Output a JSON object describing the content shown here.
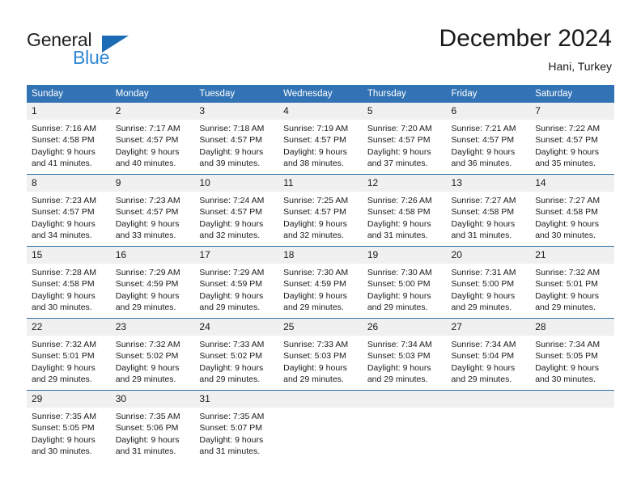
{
  "logo": {
    "word1": "General",
    "word2": "Blue",
    "triangle_color": "#1c6cb5",
    "word2_color": "#2e87d3"
  },
  "header": {
    "title": "December 2024",
    "subtitle": "Hani, Turkey"
  },
  "theme": {
    "header_blue": "#3273b5",
    "row_divider_blue": "#2e6da4",
    "daynum_band": "#f0f0f0"
  },
  "calendar": {
    "weekday_headers": [
      "Sunday",
      "Monday",
      "Tuesday",
      "Wednesday",
      "Thursday",
      "Friday",
      "Saturday"
    ],
    "labels": {
      "sunrise": "Sunrise:",
      "sunset": "Sunset:",
      "daylight": "Daylight:"
    },
    "weeks": [
      [
        {
          "day": "1",
          "sunrise": "Sunrise: 7:16 AM",
          "sunset": "Sunset: 4:58 PM",
          "daylight_line1": "Daylight: 9 hours",
          "daylight_line2": "and 41 minutes."
        },
        {
          "day": "2",
          "sunrise": "Sunrise: 7:17 AM",
          "sunset": "Sunset: 4:57 PM",
          "daylight_line1": "Daylight: 9 hours",
          "daylight_line2": "and 40 minutes."
        },
        {
          "day": "3",
          "sunrise": "Sunrise: 7:18 AM",
          "sunset": "Sunset: 4:57 PM",
          "daylight_line1": "Daylight: 9 hours",
          "daylight_line2": "and 39 minutes."
        },
        {
          "day": "4",
          "sunrise": "Sunrise: 7:19 AM",
          "sunset": "Sunset: 4:57 PM",
          "daylight_line1": "Daylight: 9 hours",
          "daylight_line2": "and 38 minutes."
        },
        {
          "day": "5",
          "sunrise": "Sunrise: 7:20 AM",
          "sunset": "Sunset: 4:57 PM",
          "daylight_line1": "Daylight: 9 hours",
          "daylight_line2": "and 37 minutes."
        },
        {
          "day": "6",
          "sunrise": "Sunrise: 7:21 AM",
          "sunset": "Sunset: 4:57 PM",
          "daylight_line1": "Daylight: 9 hours",
          "daylight_line2": "and 36 minutes."
        },
        {
          "day": "7",
          "sunrise": "Sunrise: 7:22 AM",
          "sunset": "Sunset: 4:57 PM",
          "daylight_line1": "Daylight: 9 hours",
          "daylight_line2": "and 35 minutes."
        }
      ],
      [
        {
          "day": "8",
          "sunrise": "Sunrise: 7:23 AM",
          "sunset": "Sunset: 4:57 PM",
          "daylight_line1": "Daylight: 9 hours",
          "daylight_line2": "and 34 minutes."
        },
        {
          "day": "9",
          "sunrise": "Sunrise: 7:23 AM",
          "sunset": "Sunset: 4:57 PM",
          "daylight_line1": "Daylight: 9 hours",
          "daylight_line2": "and 33 minutes."
        },
        {
          "day": "10",
          "sunrise": "Sunrise: 7:24 AM",
          "sunset": "Sunset: 4:57 PM",
          "daylight_line1": "Daylight: 9 hours",
          "daylight_line2": "and 32 minutes."
        },
        {
          "day": "11",
          "sunrise": "Sunrise: 7:25 AM",
          "sunset": "Sunset: 4:57 PM",
          "daylight_line1": "Daylight: 9 hours",
          "daylight_line2": "and 32 minutes."
        },
        {
          "day": "12",
          "sunrise": "Sunrise: 7:26 AM",
          "sunset": "Sunset: 4:58 PM",
          "daylight_line1": "Daylight: 9 hours",
          "daylight_line2": "and 31 minutes."
        },
        {
          "day": "13",
          "sunrise": "Sunrise: 7:27 AM",
          "sunset": "Sunset: 4:58 PM",
          "daylight_line1": "Daylight: 9 hours",
          "daylight_line2": "and 31 minutes."
        },
        {
          "day": "14",
          "sunrise": "Sunrise: 7:27 AM",
          "sunset": "Sunset: 4:58 PM",
          "daylight_line1": "Daylight: 9 hours",
          "daylight_line2": "and 30 minutes."
        }
      ],
      [
        {
          "day": "15",
          "sunrise": "Sunrise: 7:28 AM",
          "sunset": "Sunset: 4:58 PM",
          "daylight_line1": "Daylight: 9 hours",
          "daylight_line2": "and 30 minutes."
        },
        {
          "day": "16",
          "sunrise": "Sunrise: 7:29 AM",
          "sunset": "Sunset: 4:59 PM",
          "daylight_line1": "Daylight: 9 hours",
          "daylight_line2": "and 29 minutes."
        },
        {
          "day": "17",
          "sunrise": "Sunrise: 7:29 AM",
          "sunset": "Sunset: 4:59 PM",
          "daylight_line1": "Daylight: 9 hours",
          "daylight_line2": "and 29 minutes."
        },
        {
          "day": "18",
          "sunrise": "Sunrise: 7:30 AM",
          "sunset": "Sunset: 4:59 PM",
          "daylight_line1": "Daylight: 9 hours",
          "daylight_line2": "and 29 minutes."
        },
        {
          "day": "19",
          "sunrise": "Sunrise: 7:30 AM",
          "sunset": "Sunset: 5:00 PM",
          "daylight_line1": "Daylight: 9 hours",
          "daylight_line2": "and 29 minutes."
        },
        {
          "day": "20",
          "sunrise": "Sunrise: 7:31 AM",
          "sunset": "Sunset: 5:00 PM",
          "daylight_line1": "Daylight: 9 hours",
          "daylight_line2": "and 29 minutes."
        },
        {
          "day": "21",
          "sunrise": "Sunrise: 7:32 AM",
          "sunset": "Sunset: 5:01 PM",
          "daylight_line1": "Daylight: 9 hours",
          "daylight_line2": "and 29 minutes."
        }
      ],
      [
        {
          "day": "22",
          "sunrise": "Sunrise: 7:32 AM",
          "sunset": "Sunset: 5:01 PM",
          "daylight_line1": "Daylight: 9 hours",
          "daylight_line2": "and 29 minutes."
        },
        {
          "day": "23",
          "sunrise": "Sunrise: 7:32 AM",
          "sunset": "Sunset: 5:02 PM",
          "daylight_line1": "Daylight: 9 hours",
          "daylight_line2": "and 29 minutes."
        },
        {
          "day": "24",
          "sunrise": "Sunrise: 7:33 AM",
          "sunset": "Sunset: 5:02 PM",
          "daylight_line1": "Daylight: 9 hours",
          "daylight_line2": "and 29 minutes."
        },
        {
          "day": "25",
          "sunrise": "Sunrise: 7:33 AM",
          "sunset": "Sunset: 5:03 PM",
          "daylight_line1": "Daylight: 9 hours",
          "daylight_line2": "and 29 minutes."
        },
        {
          "day": "26",
          "sunrise": "Sunrise: 7:34 AM",
          "sunset": "Sunset: 5:03 PM",
          "daylight_line1": "Daylight: 9 hours",
          "daylight_line2": "and 29 minutes."
        },
        {
          "day": "27",
          "sunrise": "Sunrise: 7:34 AM",
          "sunset": "Sunset: 5:04 PM",
          "daylight_line1": "Daylight: 9 hours",
          "daylight_line2": "and 29 minutes."
        },
        {
          "day": "28",
          "sunrise": "Sunrise: 7:34 AM",
          "sunset": "Sunset: 5:05 PM",
          "daylight_line1": "Daylight: 9 hours",
          "daylight_line2": "and 30 minutes."
        }
      ],
      [
        {
          "day": "29",
          "sunrise": "Sunrise: 7:35 AM",
          "sunset": "Sunset: 5:05 PM",
          "daylight_line1": "Daylight: 9 hours",
          "daylight_line2": "and 30 minutes."
        },
        {
          "day": "30",
          "sunrise": "Sunrise: 7:35 AM",
          "sunset": "Sunset: 5:06 PM",
          "daylight_line1": "Daylight: 9 hours",
          "daylight_line2": "and 31 minutes."
        },
        {
          "day": "31",
          "sunrise": "Sunrise: 7:35 AM",
          "sunset": "Sunset: 5:07 PM",
          "daylight_line1": "Daylight: 9 hours",
          "daylight_line2": "and 31 minutes."
        },
        {
          "day": "",
          "sunrise": "",
          "sunset": "",
          "daylight_line1": "",
          "daylight_line2": ""
        },
        {
          "day": "",
          "sunrise": "",
          "sunset": "",
          "daylight_line1": "",
          "daylight_line2": ""
        },
        {
          "day": "",
          "sunrise": "",
          "sunset": "",
          "daylight_line1": "",
          "daylight_line2": ""
        },
        {
          "day": "",
          "sunrise": "",
          "sunset": "",
          "daylight_line1": "",
          "daylight_line2": ""
        }
      ]
    ]
  }
}
